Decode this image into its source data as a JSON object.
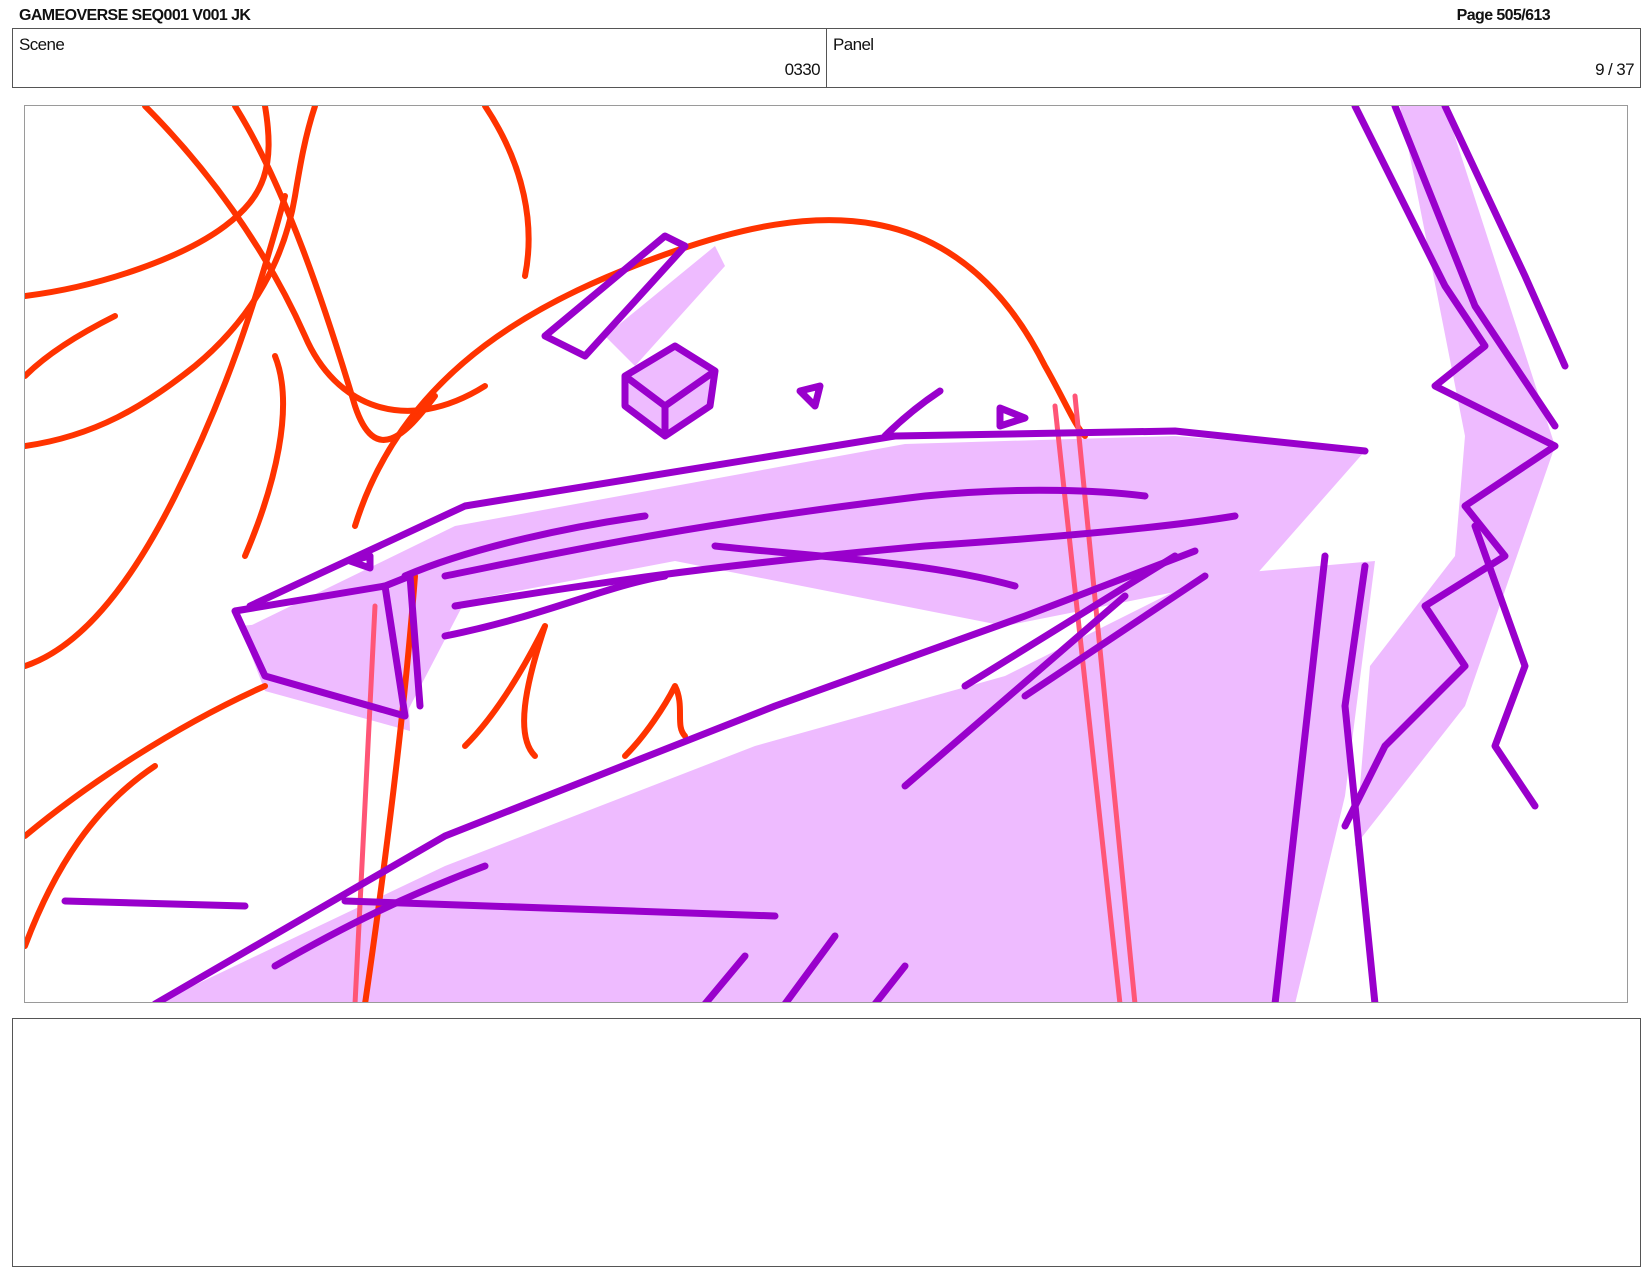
{
  "header": {
    "title": "GAMEOVERSE SEQ001 V001 JK",
    "page": "Page 505/613"
  },
  "info": {
    "scene_label": "Scene",
    "scene_value": "0330",
    "panel_label": "Panel",
    "panel_value": "9 / 37"
  },
  "sketch": {
    "colors": {
      "red_lines": "#ff3300",
      "pink_lines": "#ff5577",
      "purple_lines": "#9900cc",
      "purple_fill": "#eebbff"
    }
  },
  "notes": {
    "text": ""
  }
}
